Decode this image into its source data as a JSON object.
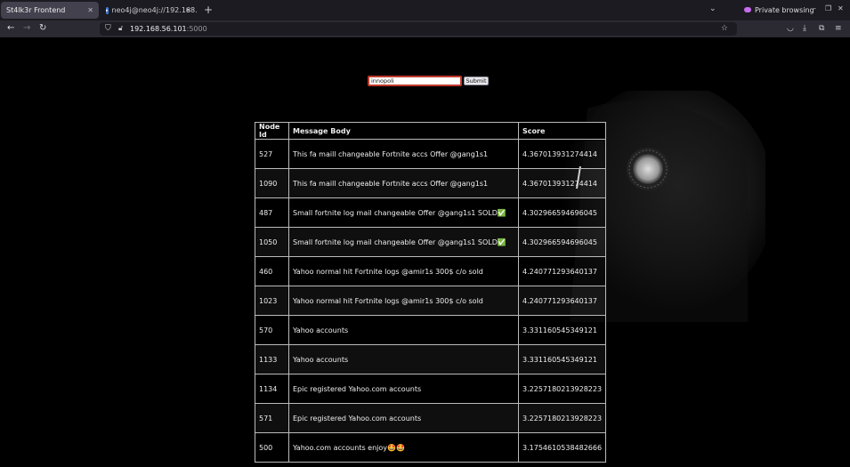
{
  "browser": {
    "tabs": [
      {
        "title": "St4lk3r Frontend",
        "active": true
      },
      {
        "title": "neo4j@neo4j://192.168.",
        "active": false
      }
    ],
    "private_label": "Private browsing",
    "url_host": "192.168.56.101",
    "url_port": ":5000"
  },
  "search": {
    "value": "innopoli",
    "submit_label": "Submit"
  },
  "table": {
    "headers": [
      "Node Id",
      "Message Body",
      "Score"
    ],
    "rows": [
      {
        "id": "527",
        "body": "This fa maill changeable Fortnite accs Offer @gang1s1",
        "score": "4.367013931274414"
      },
      {
        "id": "1090",
        "body": "This fa maill changeable Fortnite accs Offer @gang1s1",
        "score": "4.367013931274414"
      },
      {
        "id": "487",
        "body": "Small fortnite log mail changeable Offer @gang1s1 SOLD✅",
        "score": "4.302966594696045"
      },
      {
        "id": "1050",
        "body": "Small fortnite log mail changeable Offer @gang1s1 SOLD✅",
        "score": "4.302966594696045"
      },
      {
        "id": "460",
        "body": "Yahoo normal hit Fortnite logs @amir1s 300$ c/o sold",
        "score": "4.240771293640137"
      },
      {
        "id": "1023",
        "body": "Yahoo normal hit Fortnite logs @amir1s 300$ c/o sold",
        "score": "4.240771293640137"
      },
      {
        "id": "570",
        "body": "Yahoo accounts",
        "score": "3.331160545349121"
      },
      {
        "id": "1133",
        "body": "Yahoo accounts",
        "score": "3.331160545349121"
      },
      {
        "id": "1134",
        "body": "Epic registered Yahoo.com accounts",
        "score": "3.2257180213928223"
      },
      {
        "id": "571",
        "body": "Epic registered Yahoo.com accounts",
        "score": "3.2257180213928223"
      },
      {
        "id": "500",
        "body": "Yahoo.com accounts enjoy🤩🤩",
        "score": "3.1754610538482666"
      }
    ]
  }
}
